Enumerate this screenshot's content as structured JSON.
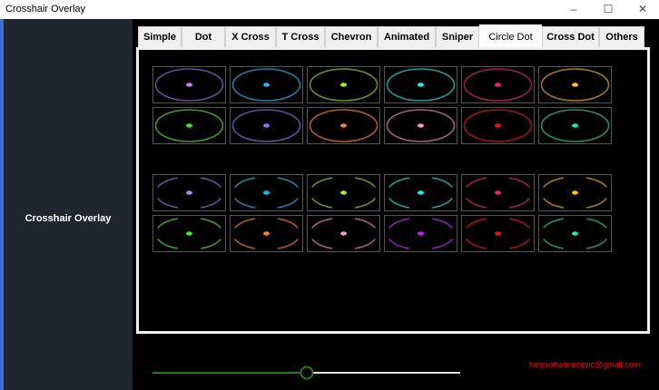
{
  "window": {
    "title": "Crosshair Overlay",
    "minimize": "–",
    "maximize": "☐",
    "close": "✕"
  },
  "sidebar": {
    "label": "Crosshair Overlay",
    "accent": "#3a6fd8"
  },
  "tabs": [
    "Simple",
    "Dot",
    "X Cross",
    "T Cross",
    "Chevron",
    "Animated",
    "Sniper",
    "Circle Dot",
    "Cross Dot",
    "Others"
  ],
  "selected_tab": "Circle Dot",
  "crosshairs": {
    "solid_rows": [
      [
        {
          "ring": "#6a4c8f",
          "dot": "#c080ff"
        },
        {
          "ring": "#1e7fa0",
          "dot": "#20b8f0"
        },
        {
          "ring": "#6c8e1e",
          "dot": "#a0f020"
        },
        {
          "ring": "#1f9a90",
          "dot": "#20f0f0"
        },
        {
          "ring": "#9a1e55",
          "dot": "#f0207a"
        },
        {
          "ring": "#a07a1a",
          "dot": "#ffc020"
        }
      ],
      [
        {
          "ring": "#3a9a2a",
          "dot": "#30f020"
        },
        {
          "ring": "#5a50a0",
          "dot": "#8080f0"
        },
        {
          "ring": "#b05a1a",
          "dot": "#ff8020"
        },
        {
          "ring": "#a06080",
          "dot": "#f0a0d0"
        },
        {
          "ring": "#a01020",
          "dot": "#f01010"
        },
        {
          "ring": "#1a9060",
          "dot": "#20f0a0"
        }
      ]
    ],
    "broken_rows": [
      [
        {
          "ring": "#6a4c8f",
          "dot": "#c080ff"
        },
        {
          "ring": "#1e7fa0",
          "dot": "#20b8f0"
        },
        {
          "ring": "#6c8e1e",
          "dot": "#a0f020"
        },
        {
          "ring": "#1f9a90",
          "dot": "#20f0f0"
        },
        {
          "ring": "#9a1e55",
          "dot": "#f0207a"
        },
        {
          "ring": "#a07a1a",
          "dot": "#ffc020"
        }
      ],
      [
        {
          "ring": "#3a9a2a",
          "dot": "#30f020"
        },
        {
          "ring": "#b05a1a",
          "dot": "#ff8020"
        },
        {
          "ring": "#a06080",
          "dot": "#f0a0d0"
        },
        {
          "ring": "#8a20b0",
          "dot": "#c020f0"
        },
        {
          "ring": "#a01020",
          "dot": "#f01010"
        },
        {
          "ring": "#1a9060",
          "dot": "#20f0a0"
        }
      ]
    ]
  },
  "size_slider": {
    "value_percent": 50,
    "fill_color": "#2a7a1a"
  },
  "email": "helpsoftwaredevic@gmail.com"
}
